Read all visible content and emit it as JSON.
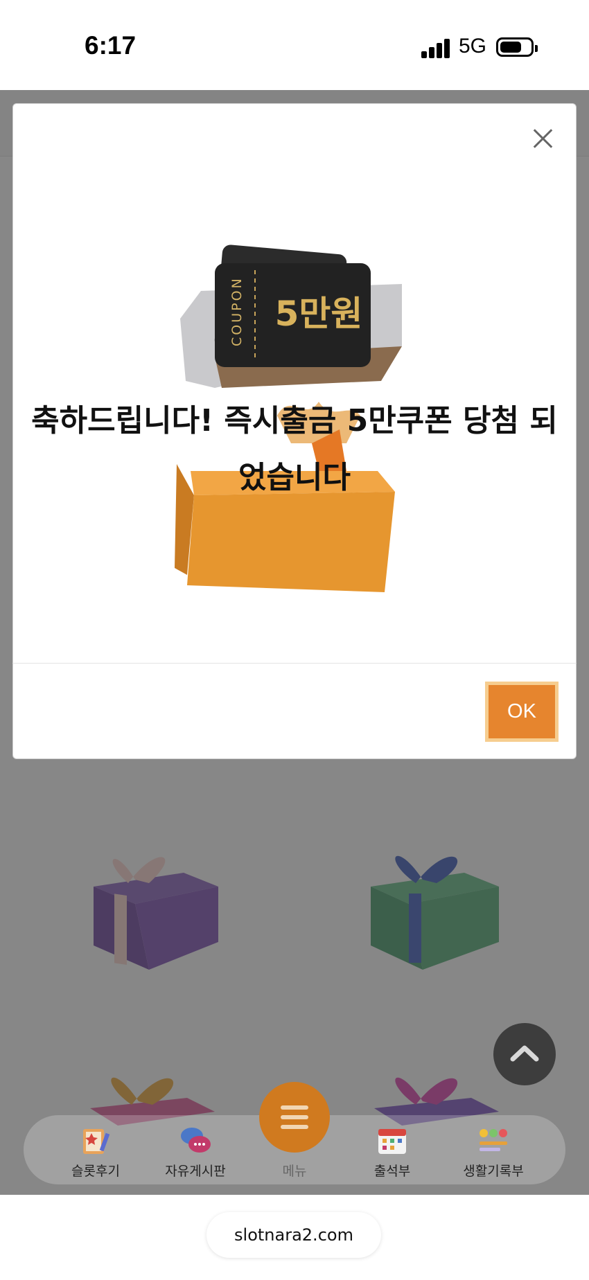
{
  "status_bar": {
    "time": "6:17",
    "network": "5G"
  },
  "modal": {
    "coupon_label": "COUPON",
    "coupon_amount": "5만원",
    "message": "축하드립니다! 즉시출금 5만쿠폰 당첨 되었습니다",
    "ok_label": "OK"
  },
  "bottom_nav": {
    "items": [
      {
        "label": "슬롯후기",
        "icon": "review-note-icon"
      },
      {
        "label": "자유게시판",
        "icon": "chat-bubbles-icon"
      },
      {
        "label": "메뉴",
        "icon": "hamburger-menu-icon"
      },
      {
        "label": "출석부",
        "icon": "calendar-icon"
      },
      {
        "label": "생활기록부",
        "icon": "emoji-chart-icon"
      }
    ]
  },
  "browser": {
    "url": "slotnara2.com"
  },
  "colors": {
    "accent": "#e6852e",
    "overlay": "#464646",
    "menu_button": "#d07a1f"
  }
}
